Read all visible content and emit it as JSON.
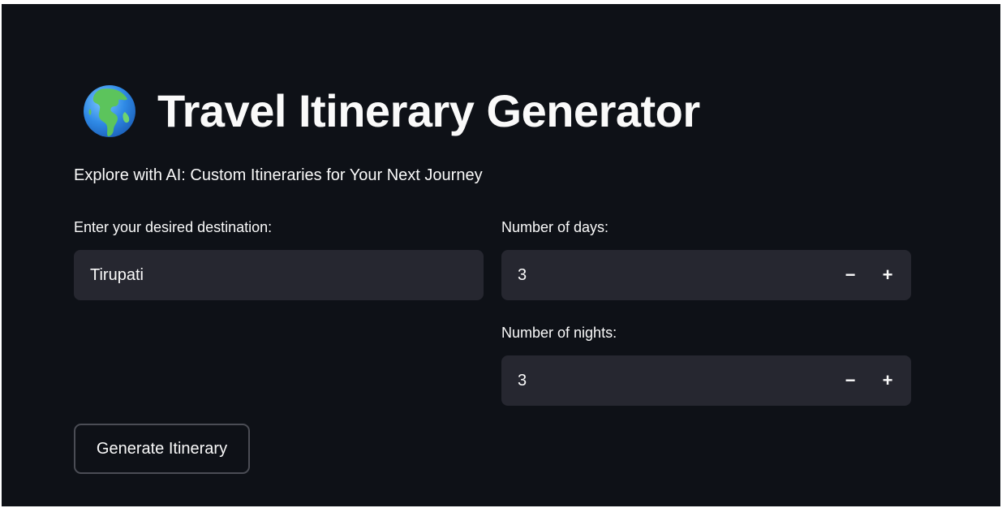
{
  "header": {
    "icon": "globe-icon",
    "title": "Travel Itinerary Generator",
    "subtitle": "Explore with AI: Custom Itineraries for Your Next Journey"
  },
  "form": {
    "destination": {
      "label": "Enter your desired destination:",
      "value": "Tirupati"
    },
    "days": {
      "label": "Number of days:",
      "value": "3",
      "decrement_label": "−",
      "increment_label": "+"
    },
    "nights": {
      "label": "Number of nights:",
      "value": "3",
      "decrement_label": "−",
      "increment_label": "+"
    },
    "submit_label": "Generate Itinerary"
  },
  "colors": {
    "background": "#0e1117",
    "input_background": "#262730",
    "text": "#fafafa",
    "button_border": "#4b4d55"
  }
}
